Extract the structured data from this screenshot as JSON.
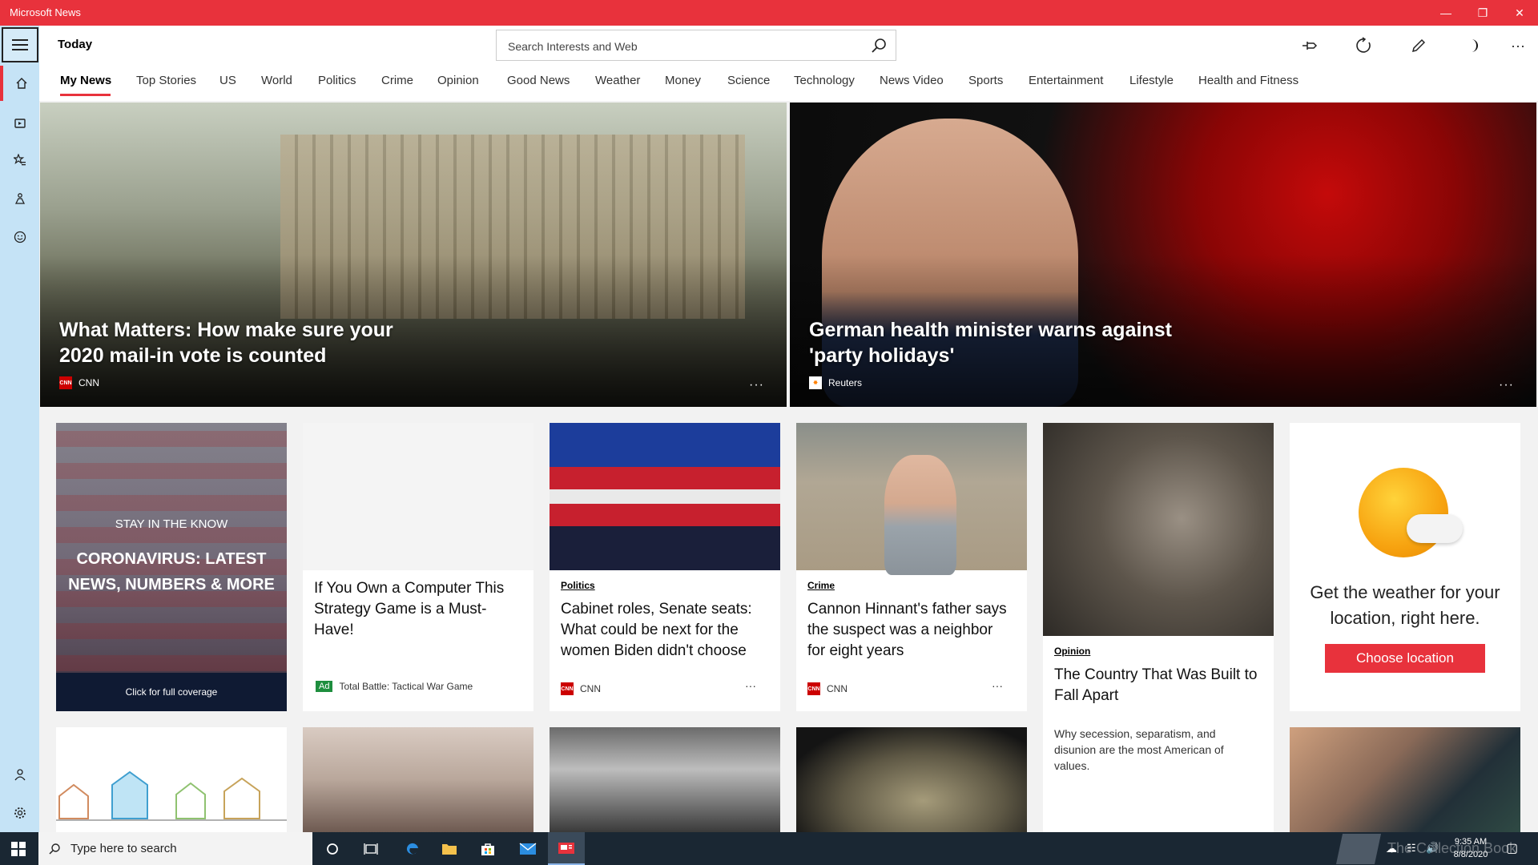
{
  "window": {
    "title": "Microsoft News"
  },
  "header": {
    "page_title": "Today",
    "search_placeholder": "Search Interests and Web"
  },
  "nav": {
    "tabs": [
      "My News",
      "Top Stories",
      "US",
      "World",
      "Politics",
      "Crime",
      "Opinion",
      "Good News",
      "Weather",
      "Money",
      "Science",
      "Technology",
      "News Video",
      "Sports",
      "Entertainment",
      "Lifestyle",
      "Health and Fitness"
    ],
    "active": "My News"
  },
  "heroes": [
    {
      "title": "What Matters: How make sure your 2020 mail-in vote is counted",
      "source": "CNN"
    },
    {
      "title": "German health minister warns against 'party holidays'",
      "source": "Reuters"
    }
  ],
  "cards": {
    "covid": {
      "kicker": "STAY IN THE KNOW",
      "title": "CORONAVIRUS: LATEST NEWS, NUMBERS & MORE",
      "footer": "Click for full coverage"
    },
    "ad": {
      "title": "If You Own a Computer This Strategy Game is a Must-Have!",
      "badge": "Ad",
      "source": "Total Battle: Tactical War Game"
    },
    "politics": {
      "category": "Politics",
      "title": "Cabinet roles, Senate seats: What could be next for the women Biden didn't choose",
      "source": "CNN"
    },
    "crime": {
      "category": "Crime",
      "title": "Cannon Hinnant's father says the suspect was a neighbor for eight years",
      "source": "CNN"
    },
    "opinion": {
      "category": "Opinion",
      "title": "The Country That Was Built to Fall Apart",
      "summary": "Why secession, separatism, and disunion are the most American of values."
    },
    "weather": {
      "title": "Get the weather for your location, right here.",
      "button": "Choose location"
    }
  },
  "taskbar": {
    "search_placeholder": "Type here to search",
    "time": "9:35 AM",
    "date": "8/8/2020",
    "watermark": "The Collection Book"
  },
  "colors": {
    "accent": "#e8323c",
    "rail": "#c5e3f6",
    "taskbar": "#1a2733"
  }
}
